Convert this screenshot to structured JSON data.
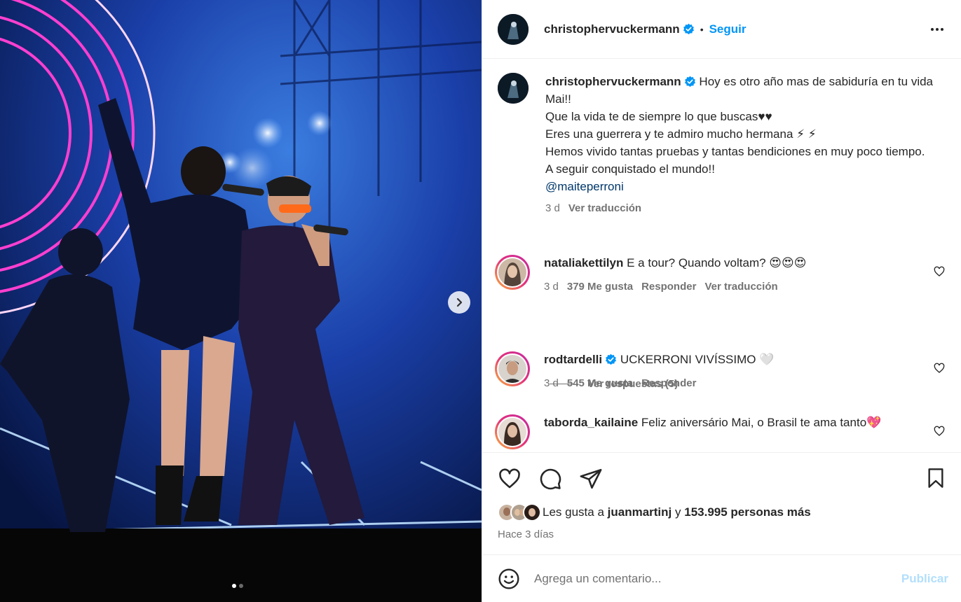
{
  "post": {
    "author": "christophervuckermann",
    "follow_separator": "•",
    "follow_label": "Seguir",
    "caption_lines": [
      "Hoy es otro año mas de sabiduría en tu vida Mai!!",
      "Que la vida te de siempre lo que buscas♥♥",
      "Eres una guerrera y te admiro mucho hermana ⚡ ⚡",
      "Hemos vivido tantas pruebas y tantas bendiciones en muy poco tiempo.",
      "A seguir conquistado el mundo!!"
    ],
    "caption_mention": "@maiteperroni",
    "caption_time": "3 d",
    "caption_translate": "Ver traducción"
  },
  "comments": [
    {
      "user": "nataliakettilyn",
      "text": "E a tour? Quando voltam? 😍😍😍",
      "time": "3 d",
      "likes": "379 Me gusta",
      "reply": "Responder",
      "translate": "Ver traducción",
      "view_replies": "Ver respuestas (5)"
    },
    {
      "user": "rodtardelli",
      "text": "UCKERRONI VIVÍSSIMO 🤍",
      "time": "3 d",
      "likes": "545 Me gusta",
      "reply": "Responder"
    },
    {
      "user": "taborda_kailaine",
      "text": "Feliz aniversário Mai, o Brasil te ama tanto💖"
    }
  ],
  "footer": {
    "likes_prefix": "Les gusta a ",
    "likes_user": "juanmartinj",
    "likes_mid": " y ",
    "likes_count": "153.995 personas más",
    "posted_ago": "Hace 3 días",
    "comment_placeholder": "Agrega un comentario...",
    "publish_label": "Publicar"
  },
  "carousel": {
    "current_slide": 1,
    "total_slides": 2
  },
  "colors": {
    "link": "#0095f6",
    "mention": "#00376b",
    "muted": "#737373",
    "text": "#262626",
    "publish_disabled": "#b2dffc"
  }
}
